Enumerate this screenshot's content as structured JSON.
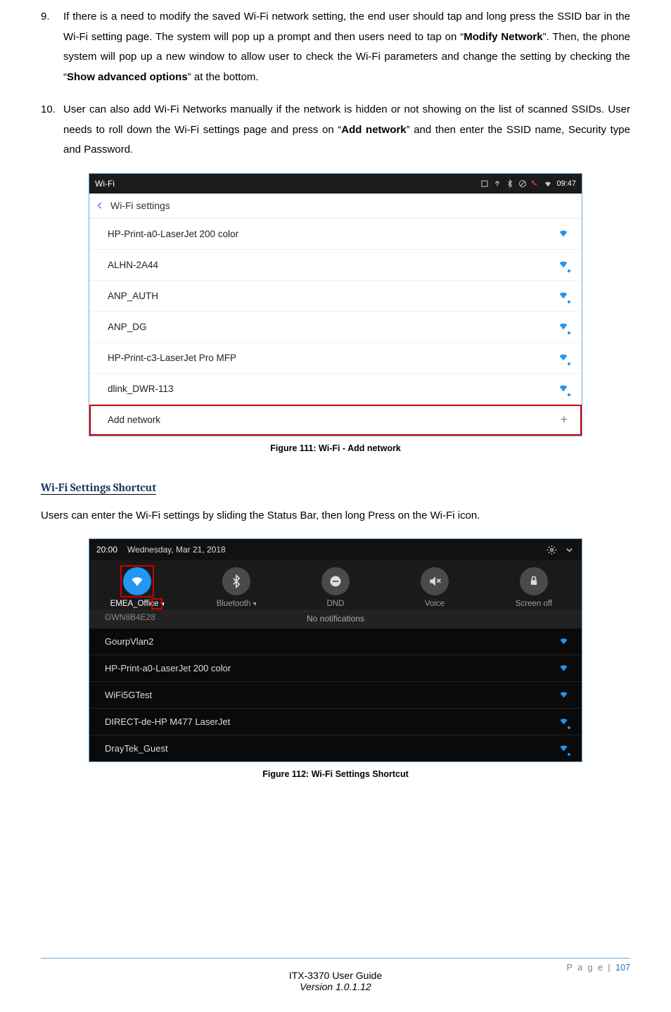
{
  "items": {
    "nine": {
      "num": "9.",
      "text_before": "If there is a need to modify the saved Wi-Fi network setting, the end user should tap and long press the SSID bar in the Wi-Fi setting page. The system will pop up a prompt and then users need to tap on “",
      "bold1": "Modify Network",
      "text_mid": "”. Then, the phone system will pop up a new window to allow user to check the Wi-Fi parameters and change the setting by checking the “",
      "bold2": "Show advanced options",
      "text_after": "” at the bottom."
    },
    "ten": {
      "num": "10.",
      "text_before": "User can also add Wi-Fi Networks manually if the network is hidden or not showing on the list of scanned SSIDs. User needs to roll down the Wi-Fi settings page and press on “",
      "bold1": "Add network",
      "text_after": "” and then enter the SSID name, Security type and Password."
    }
  },
  "fig1": {
    "topbar_title": "Wi-Fi",
    "topbar_time": "09:47",
    "back_label": "Wi-Fi settings",
    "rows": [
      "HP-Print-a0-LaserJet 200 color",
      "ALHN-2A44",
      "ANP_AUTH",
      "ANP_DG",
      "HP-Print-c3-LaserJet Pro MFP",
      "dlink_DWR-113"
    ],
    "add_label": "Add network",
    "caption": "Figure 111: Wi-Fi - Add network"
  },
  "section_heading": "Wi-Fi Settings Shortcut",
  "shortcut_para": "Users can enter the Wi-Fi settings by sliding the Status Bar, then long Press on the Wi-Fi icon.",
  "fig2": {
    "time": "20:00",
    "date": "Wednesday, Mar 21, 2018",
    "qs": {
      "wifi": "EMEA_Office",
      "bt": "Bluetooth",
      "dnd": "DND",
      "voice": "Voice",
      "screen": "Screen off"
    },
    "notif": "No notifications",
    "behind": "GWN8B4E28",
    "rows": [
      "GourpVlan2",
      "HP-Print-a0-LaserJet 200 color",
      "WiFi5GTest",
      "DIRECT-de-HP M477 LaserJet",
      "DrayTek_Guest"
    ],
    "caption": "Figure 112: Wi-Fi Settings Shortcut"
  },
  "footer": {
    "page_label": "P a g e | ",
    "page_num": "107",
    "guide": "ITX-3370 User Guide",
    "version": "Version 1.0.1.12"
  }
}
